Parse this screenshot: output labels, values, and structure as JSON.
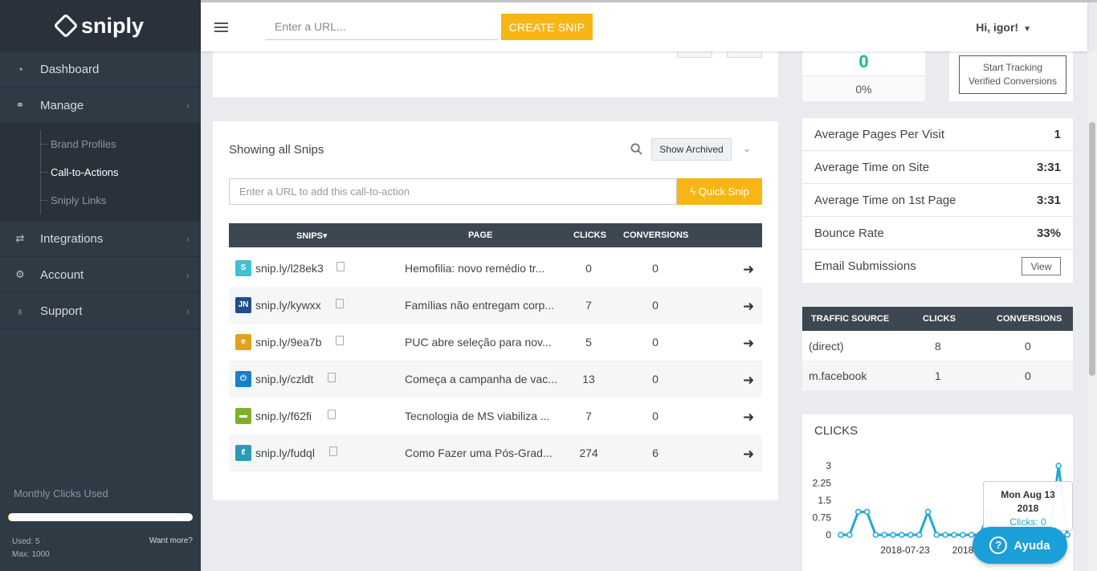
{
  "app": {
    "name": "sniply"
  },
  "sidebar": {
    "items": [
      {
        "label": "Dashboard",
        "icon": "dashboard-icon"
      },
      {
        "label": "Manage",
        "icon": "link-icon"
      },
      {
        "label": "Integrations",
        "icon": "exchange-icon"
      },
      {
        "label": "Account",
        "icon": "gear-icon"
      },
      {
        "label": "Support",
        "icon": "lightbulb-icon"
      }
    ],
    "submenu": [
      {
        "label": "Brand Profiles"
      },
      {
        "label": "Call-to-Actions"
      },
      {
        "label": "Sniply Links"
      }
    ],
    "monthly_label": "Monthly Clicks Used",
    "used": "Used: 5",
    "max": "Max: 1000",
    "want_more": "Want more?",
    "usage_fraction": 0.005
  },
  "topbar": {
    "url_placeholder": "Enter a URL...",
    "create_label": "CREATE SNIP",
    "greeting": "Hi, igor!"
  },
  "snips": {
    "title": "Showing all Snips",
    "archived_label": "Show Archived",
    "cta_placeholder": "Enter a URL to add this call-to-action",
    "quick_label": "Quick Snip",
    "headers": {
      "snips": "SNIPS▾",
      "page": "PAGE",
      "clicks": "CLICKS",
      "conversions": "CONVERSIONS"
    },
    "rows": [
      {
        "link": "snip.ly/l28ek3",
        "page": "Hemofilia: novo remédio tr...",
        "clicks": "0",
        "conversions": "0",
        "fav_color": "#3fc1d0",
        "fav_text": "S"
      },
      {
        "link": "snip.ly/kywxx",
        "page": "Famílias não entregam corp...",
        "clicks": "7",
        "conversions": "0",
        "fav_color": "#1f4e8c",
        "fav_text": "JN"
      },
      {
        "link": "snip.ly/9ea7b",
        "page": "PUC abre seleção para nov...",
        "clicks": "5",
        "conversions": "0",
        "fav_color": "#e0a21a",
        "fav_text": "e"
      },
      {
        "link": "snip.ly/czldt",
        "page": "Começa a campanha de vac...",
        "clicks": "13",
        "conversions": "0",
        "fav_color": "#1a7fc9",
        "fav_text": "⏻"
      },
      {
        "link": "snip.ly/f62fi",
        "page": "Tecnologia de MS viabiliza ...",
        "clicks": "7",
        "conversions": "0",
        "fav_color": "#7fae2c",
        "fav_text": "▬"
      },
      {
        "link": "snip.ly/fudql",
        "page": "Como Fazer uma Pós-Grad...",
        "clicks": "274",
        "conversions": "6",
        "fav_color": "#2a9bb5",
        "fav_text": "ℓ"
      }
    ]
  },
  "stats": {
    "conversions_value": "0",
    "conversions_pct": "0%",
    "track_label_1": "Start Tracking",
    "track_label_2": "Verified Conversions"
  },
  "metrics": [
    {
      "label": "Average Pages Per Visit",
      "value": "1"
    },
    {
      "label": "Average Time on Site",
      "value": "3:31"
    },
    {
      "label": "Average Time on 1st Page",
      "value": "3:31"
    },
    {
      "label": "Bounce Rate",
      "value": "33%"
    },
    {
      "label": "Email Submissions",
      "button": "View"
    }
  ],
  "traffic": {
    "headers": {
      "source": "TRAFFIC SOURCE",
      "clicks": "CLICKS",
      "conversions": "CONVERSIONS"
    },
    "rows": [
      {
        "source": "(direct)",
        "clicks": "8",
        "conversions": "0"
      },
      {
        "source": "m.facebook",
        "clicks": "1",
        "conversions": "0"
      }
    ]
  },
  "clicks_chart": {
    "title": "CLICKS",
    "tooltip_date": "Mon Aug 13",
    "tooltip_year": "2018",
    "tooltip_value": "Clicks: 0",
    "ayuda": "Ayuda"
  },
  "chart_data": {
    "type": "line",
    "title": "CLICKS",
    "ylim": [
      0,
      3
    ],
    "yticks": [
      "3",
      "2.25",
      "1.5",
      "0.75",
      "0"
    ],
    "xticks": [
      "2018-07-23",
      "2018"
    ],
    "values": [
      0,
      0,
      1,
      1,
      0,
      0,
      0,
      0,
      0,
      0,
      1,
      0,
      0,
      0,
      0,
      0,
      0,
      1,
      0,
      0,
      0,
      0,
      0,
      0,
      0,
      3,
      0
    ],
    "color": "#22a7d5"
  },
  "colors": {
    "accent": "#f7b614",
    "sidebar": "#2f3a45",
    "teal": "#17b897",
    "chart": "#22a7d5"
  }
}
